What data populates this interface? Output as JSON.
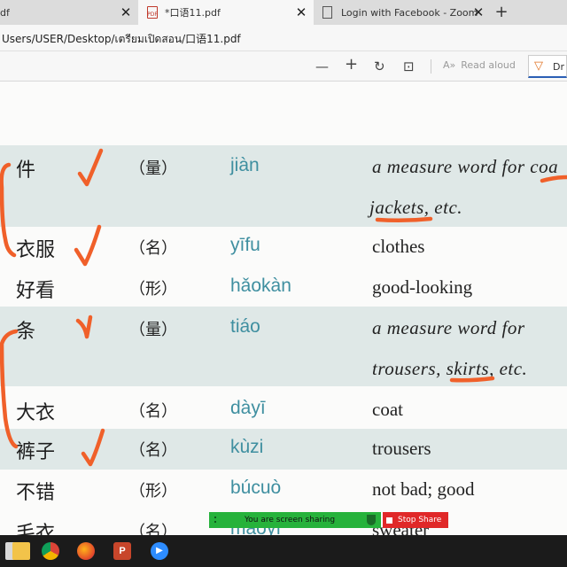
{
  "browser": {
    "tabs": [
      {
        "title": "df"
      },
      {
        "title": "*口语11.pdf",
        "icon": "pdf-file-icon"
      },
      {
        "title": "Login with Facebook - Zoom",
        "icon": "page-icon"
      }
    ],
    "close_glyph": "✕",
    "new_tab_glyph": "+",
    "address": "Users/USER/Desktop/เตรียมเปิดสอน/口语11.pdf"
  },
  "pdf_toolbar": {
    "zoom_out_glyph": "—",
    "zoom_in_glyph": "+",
    "rotate_glyph": "↻",
    "fit_glyph": "⊡",
    "read_aloud_label": "Read aloud",
    "draw_label": "Dr"
  },
  "vocab": [
    {
      "hanzi": "件",
      "pos": "（量）",
      "pinyin": "jiàn",
      "english": "a measure word for coa",
      "italic": true
    },
    {
      "hanzi": "",
      "pos": "",
      "pinyin": "",
      "english": "jackets, etc.",
      "italic": true
    },
    {
      "hanzi": "衣服",
      "pos": "（名）",
      "pinyin": "yīfu",
      "english": "clothes",
      "italic": false
    },
    {
      "hanzi": "好看",
      "pos": "（形）",
      "pinyin": "hǎokàn",
      "english": "good-looking",
      "italic": false
    },
    {
      "hanzi": "条",
      "pos": "（量）",
      "pinyin": "tiáo",
      "english": "a measure word for",
      "italic": true
    },
    {
      "hanzi": "",
      "pos": "",
      "pinyin": "",
      "english": "trousers, skirts, etc.",
      "italic": true
    },
    {
      "hanzi": "大衣",
      "pos": "（名）",
      "pinyin": "dàyī",
      "english": "coat",
      "italic": false
    },
    {
      "hanzi": "裤子",
      "pos": "（名）",
      "pinyin": "kùzi",
      "english": "trousers",
      "italic": false
    },
    {
      "hanzi": "不错",
      "pos": "（形）",
      "pinyin": "búcuò",
      "english": "not bad; good",
      "italic": false
    },
    {
      "hanzi": "毛衣",
      "pos": "（名）",
      "pinyin": "máoyī",
      "english": "sweater",
      "italic": false
    }
  ],
  "annotation_color": "#f0602a",
  "pinyin_color": "#3f8fa0",
  "band_color": "#dfe8e7",
  "screen_share": {
    "message": "You are screen sharing",
    "stop_label": "Stop Share"
  },
  "taskbar": {
    "apps": [
      "file-explorer-icon",
      "chrome-icon",
      "firefox-icon",
      "powerpoint-icon",
      "zoom-icon"
    ],
    "ppt_letter": "P"
  }
}
